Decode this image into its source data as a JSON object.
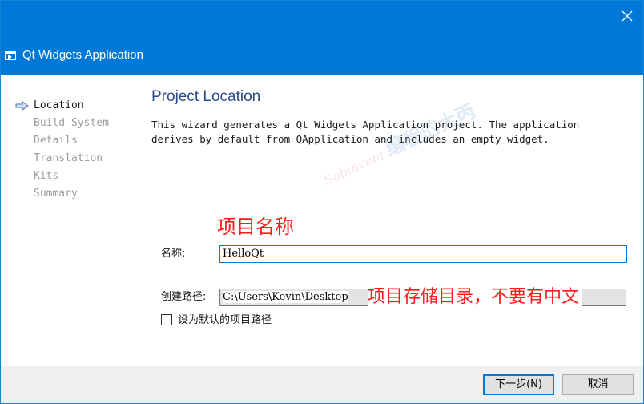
{
  "window": {
    "title": "Qt Widgets Application",
    "accent": "#0078d7"
  },
  "steps": [
    {
      "label": "Location",
      "active": true
    },
    {
      "label": "Build System",
      "active": false
    },
    {
      "label": "Details",
      "active": false
    },
    {
      "label": "Translation",
      "active": false
    },
    {
      "label": "Kits",
      "active": false
    },
    {
      "label": "Summary",
      "active": false
    }
  ],
  "page": {
    "heading": "Project Location",
    "description_line1": "This wizard generates a Qt Widgets Application project. The application",
    "description_line2": "derives by default from QApplication and includes an empty widget."
  },
  "form": {
    "name_label": "名称:",
    "name_value": "HelloQt",
    "path_label": "创建路径:",
    "path_value": "C:\\Users\\Kevin\\Desktop",
    "default_label": "设为默认的项目路径"
  },
  "annotations": {
    "name_note": "项目名称",
    "path_note": "项目存储目录，不要有中文",
    "color": "#ff1a1a"
  },
  "buttons": {
    "next": "下一步(N)",
    "cancel": "取消"
  },
  "watermark": {
    "text": "Sobinvent 编程的大丙"
  },
  "icons": {
    "close": "close-icon",
    "app": "app-icon",
    "step_marker": "arrow-right-icon"
  }
}
